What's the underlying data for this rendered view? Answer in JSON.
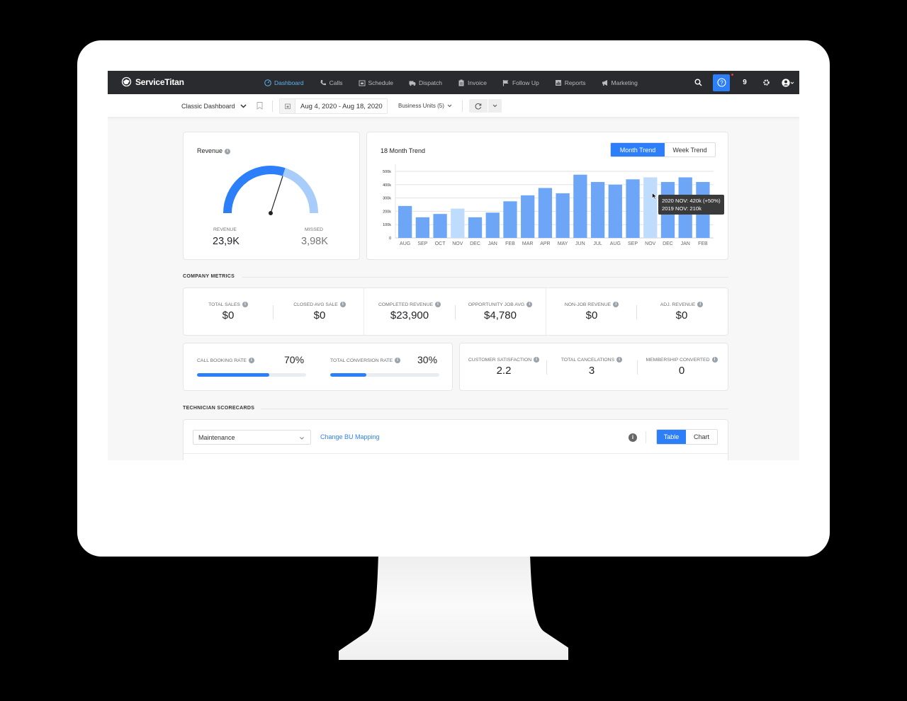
{
  "app": {
    "brand": "ServiceTitan"
  },
  "nav": {
    "items": [
      {
        "label": "Dashboard",
        "icon": "dashboard-gauge-icon",
        "active": true
      },
      {
        "label": "Calls",
        "icon": "phone-icon",
        "active": false
      },
      {
        "label": "Schedule",
        "icon": "calendar-icon",
        "active": false
      },
      {
        "label": "Dispatch",
        "icon": "truck-icon",
        "active": false
      },
      {
        "label": "Invoice",
        "icon": "clipboard-icon",
        "active": false
      },
      {
        "label": "Follow Up",
        "icon": "flag-icon",
        "active": false
      },
      {
        "label": "Reports",
        "icon": "bar-chart-icon",
        "active": false
      },
      {
        "label": "Marketing",
        "icon": "megaphone-icon",
        "active": false
      }
    ],
    "notifications_count": "9"
  },
  "toolbar": {
    "dashboard_select": "Classic Dashboard",
    "date_range": "Aug 4, 2020 - Aug 18, 2020",
    "business_units": "Business Units (5)"
  },
  "revenue_card": {
    "title": "Revenue",
    "revenue_label": "REVENUE",
    "revenue_value": "23,9K",
    "missed_label": "MISSED",
    "missed_value": "3,98K",
    "gauge_fraction": 0.6,
    "colors": {
      "revenue": "#2d7ff9",
      "missed": "#a8cdfb"
    }
  },
  "trend_card": {
    "title": "18 Month Trend",
    "toggle": [
      {
        "label": "Month Trend",
        "active": true
      },
      {
        "label": "Week Trend",
        "active": false
      }
    ],
    "tooltip": {
      "line1": "2020 NOV: 420k (+50%)",
      "line2": "2019 NOV: 210k"
    }
  },
  "chart_data": {
    "type": "bar",
    "title": "18 Month Trend",
    "xlabel": "",
    "ylabel": "",
    "ylim": [
      0,
      500000
    ],
    "yticks": [
      0,
      100000,
      200000,
      300000,
      400000,
      500000
    ],
    "ytick_labels": [
      "0",
      "100k",
      "200k",
      "300k",
      "400k",
      "500k"
    ],
    "grid": true,
    "categories": [
      "AUG",
      "SEP",
      "OCT",
      "NOV",
      "DEC",
      "JAN",
      "FEB",
      "MAR",
      "APR",
      "MAY",
      "JUN",
      "JUL",
      "AUG",
      "SEP",
      "NOV",
      "DEC",
      "JAN",
      "FEB"
    ],
    "values": [
      240000,
      155000,
      180000,
      220000,
      155000,
      190000,
      275000,
      320000,
      375000,
      335000,
      475000,
      420000,
      400000,
      440000,
      455000,
      420000,
      455000,
      420000
    ],
    "highlighted": [
      3,
      14
    ],
    "colors": {
      "bar": "#6ea6f7",
      "highlight": "#c0dcfd"
    }
  },
  "company_metrics": {
    "section_label": "COMPANY METRICS",
    "row1": [
      {
        "label": "TOTAL SALES",
        "value": "$0"
      },
      {
        "label": "CLOSED AVG SALE",
        "value": "$0"
      },
      {
        "label": "COMPLETED REVENUE",
        "value": "$23,900"
      },
      {
        "label": "OPPORTUNITY JOB AVG",
        "value": "$4,780"
      },
      {
        "label": "NON-JOB REVENUE",
        "value": "$0"
      },
      {
        "label": "ADJ. REVENUE",
        "value": "$0"
      }
    ],
    "rates": [
      {
        "label": "CALL BOOKING RATE",
        "value": "70%",
        "fraction": 0.66
      },
      {
        "label": "TOTAL CONVERSION RATE",
        "value": "30%",
        "fraction": 0.33
      }
    ],
    "row3": [
      {
        "label": "CUSTOMER SATISFACTION",
        "value": "2.2"
      },
      {
        "label": "TOTAL CANCELATIONS",
        "value": "3"
      },
      {
        "label": "MEMBERSHIP CONVERTED",
        "value": "0"
      }
    ]
  },
  "technician": {
    "section_label": "TECHNICIAN SCORECARDS",
    "bu_select": "Maintenance",
    "change_link": "Change BU Mapping",
    "view_toggle": [
      {
        "label": "Table",
        "active": true
      },
      {
        "label": "Chart",
        "active": false
      }
    ]
  }
}
